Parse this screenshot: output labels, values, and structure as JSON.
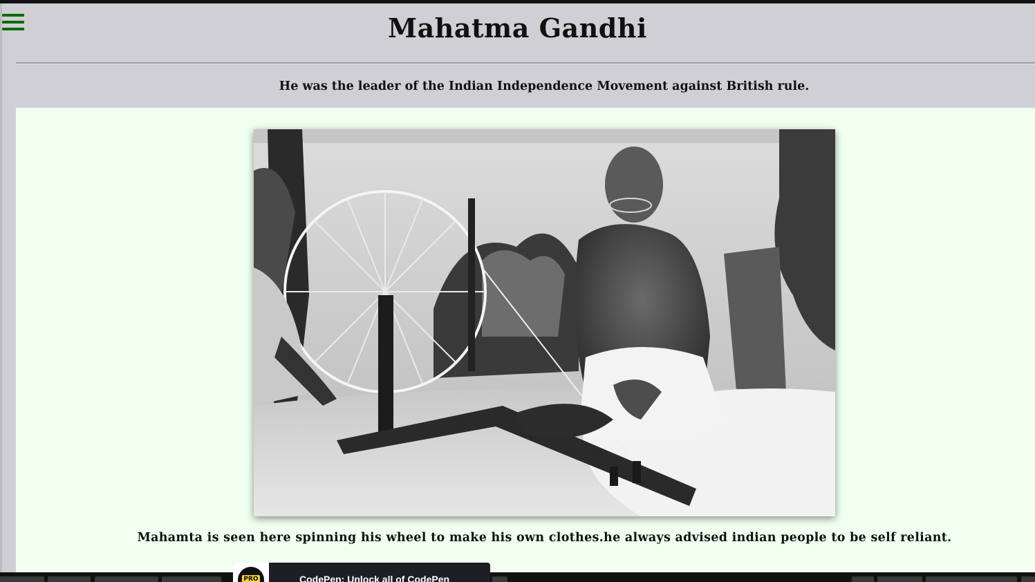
{
  "page": {
    "title": "Mahatma Gandhi",
    "subtitle": "He was the leader of the Indian Independence Movement against British rule.",
    "caption": "Mahamta is seen here spinning his wheel to make his own clothes.he always advised indian people to be self reliant."
  },
  "menu": {
    "icon": "hamburger-menu-icon"
  },
  "image": {
    "subject": "black-and-white photo of Gandhi at a spinning wheel"
  },
  "promo": {
    "badge": "PRO",
    "text": "CodePen: Unlock all of CodePen"
  },
  "colors": {
    "header_bg": "#d0d0d4",
    "content_bg": "#f0fff0",
    "menu_icon": "#0b6b0b",
    "text": "#111111"
  }
}
